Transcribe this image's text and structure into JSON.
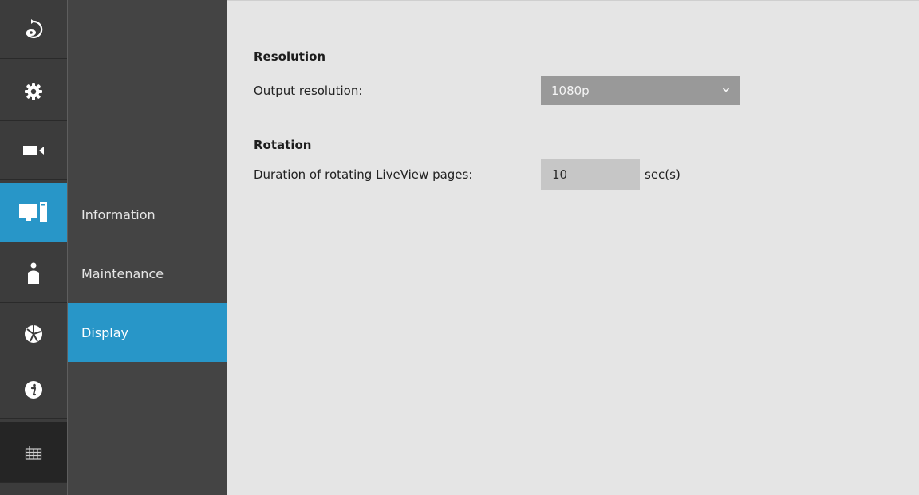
{
  "rail": {
    "items": [
      {
        "icon": "back-eye-icon"
      },
      {
        "icon": "gear-icon"
      },
      {
        "icon": "camera-icon"
      },
      {
        "icon": "monitor-pc-icon",
        "active": true
      },
      {
        "icon": "user-icon"
      },
      {
        "icon": "network-globe-icon"
      },
      {
        "icon": "info-icon"
      },
      {
        "icon": "keyboard-icon"
      }
    ]
  },
  "submenu": {
    "items": [
      {
        "label": "Information"
      },
      {
        "label": "Maintenance"
      },
      {
        "label": "Display",
        "active": true
      }
    ]
  },
  "content": {
    "resolution": {
      "title": "Resolution",
      "output_label": "Output resolution:",
      "output_value": "1080p"
    },
    "rotation": {
      "title": "Rotation",
      "duration_label": "Duration of rotating LiveView pages:",
      "duration_value": "10",
      "duration_unit": "sec(s)"
    }
  },
  "colors": {
    "accent": "#2896c8",
    "rail_bg": "#3c3c3c",
    "submenu_bg": "#444444",
    "content_bg": "#e5e5e5"
  }
}
